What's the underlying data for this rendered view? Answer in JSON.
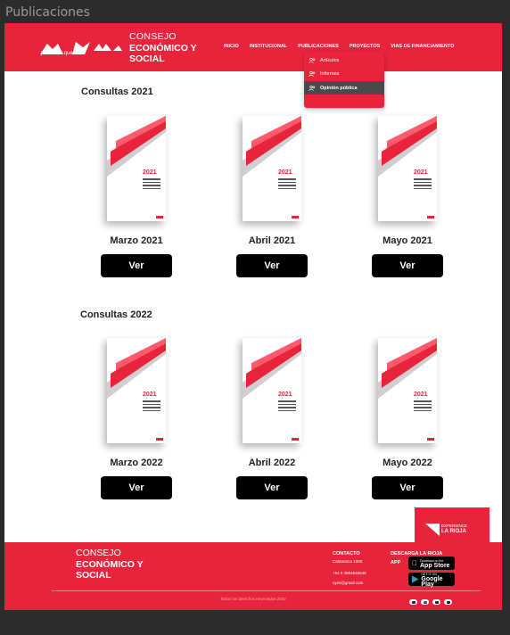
{
  "frame": {
    "title": "Publicaciones"
  },
  "header": {
    "logo_caption": "provincia que late",
    "brand_line1": "CONSEJO",
    "brand_line2": "ECONÓMICO Y",
    "brand_line3": "SOCIAL",
    "nav": [
      "INICIO",
      "INSTITUCIONAL",
      "PUBLICACIONES",
      "PROYECTOS",
      "VIAS DE FINANCIAMIENTO"
    ]
  },
  "dropdown": {
    "items": [
      "Artículos",
      "Informes",
      "Opinión pública"
    ],
    "active_index": 2
  },
  "sections": [
    {
      "title": "Consultas 2021",
      "cards": [
        {
          "label": "Marzo 2021",
          "cover_year": "2021",
          "button": "Ver"
        },
        {
          "label": "Abril 2021",
          "cover_year": "2021",
          "button": "Ver"
        },
        {
          "label": "Mayo 2021",
          "cover_year": "2021",
          "button": "Ver"
        }
      ]
    },
    {
      "title": "Consultas 2022",
      "cards": [
        {
          "label": "Marzo 2022",
          "cover_year": "2021",
          "button": "Ver"
        },
        {
          "label": "Abril 2022",
          "cover_year": "2021",
          "button": "Ver"
        },
        {
          "label": "Mayo 2022",
          "cover_year": "2021",
          "button": "Ver"
        }
      ]
    }
  ],
  "badge": {
    "small": "EXPERIENCE",
    "big": "LA RIOJA"
  },
  "footer": {
    "brand_line1": "CONSEJO",
    "brand_line2": "ECONÓMICO Y",
    "brand_line3": "SOCIAL",
    "contact_heading": "CONTACTO",
    "contact_address": "Catamarca 1000",
    "contact_phone": "+54 9 3804546546",
    "contact_email": "cyes@gmail.com",
    "download_heading_1": "DESCARGA LA RIOJA",
    "download_heading_2": "APP",
    "appstore_small": "Download on the",
    "appstore_big": "App Store",
    "googleplay_small": "GET IT ON",
    "googleplay_big": "Google Play",
    "copyright": "Todos los derechos reservados 2022",
    "socials": [
      "instagram-icon",
      "facebook-icon",
      "youtube-icon",
      "twitter-icon"
    ]
  },
  "colors": {
    "brand_red": "#e8243c",
    "button_black": "#000000",
    "dropdown_active": "#4a4a4a"
  }
}
